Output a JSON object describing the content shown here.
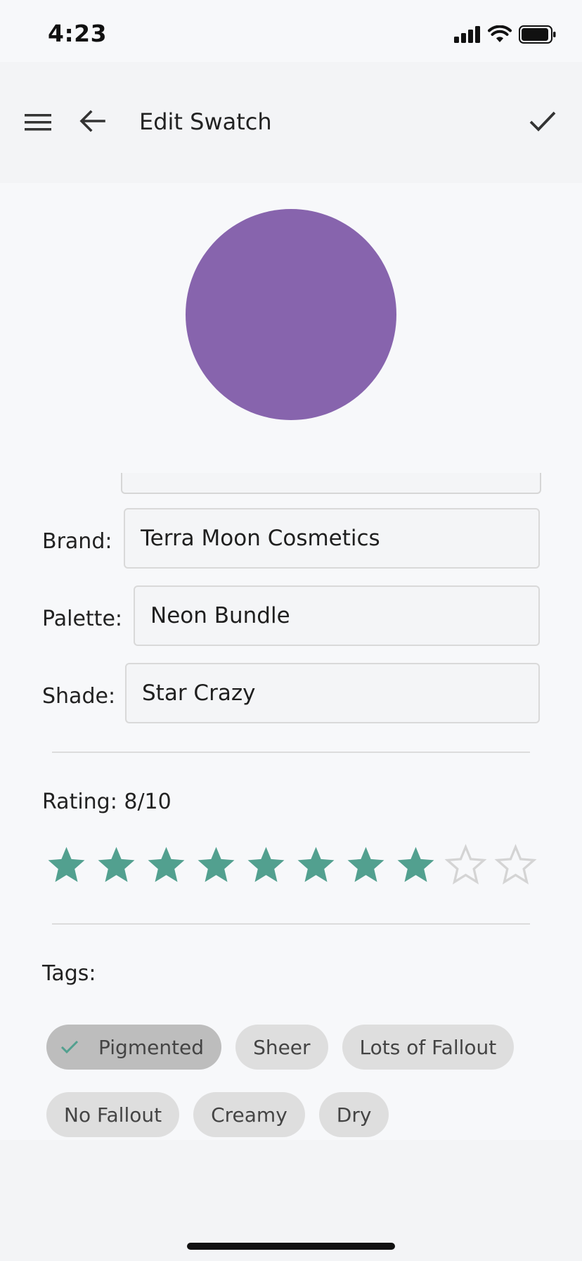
{
  "status_bar": {
    "time": "4:23"
  },
  "app_bar": {
    "title": "Edit Swatch"
  },
  "swatch": {
    "color": "#8764ad"
  },
  "fields": {
    "brand": {
      "label": "Brand:",
      "value": "Terra Moon Cosmetics"
    },
    "palette": {
      "label": "Palette:",
      "value": "Neon Bundle"
    },
    "shade": {
      "label": "Shade:",
      "value": "Star Crazy"
    }
  },
  "rating": {
    "label": "Rating: 8/10",
    "value": 8,
    "max": 10,
    "filled_color": "#52a08f",
    "empty_color": "#d4d4d4"
  },
  "tags": {
    "label": "Tags:",
    "items": [
      {
        "label": "Pigmented",
        "selected": true
      },
      {
        "label": "Sheer",
        "selected": false
      },
      {
        "label": "Lots of Fallout",
        "selected": false
      },
      {
        "label": "No Fallout",
        "selected": false
      },
      {
        "label": "Creamy",
        "selected": false
      },
      {
        "label": "Dry",
        "selected": false
      }
    ]
  },
  "icons": {
    "menu": "menu-icon",
    "back": "arrow-left-icon",
    "save": "checkmark-icon",
    "star": "star-icon",
    "chip_check": "checkmark-icon"
  }
}
